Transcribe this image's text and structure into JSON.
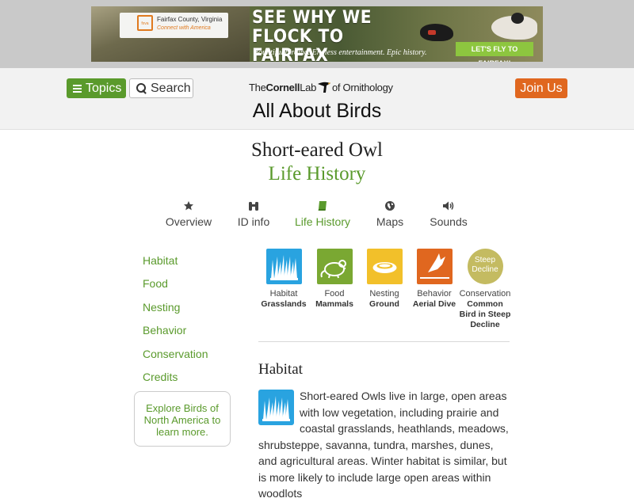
{
  "ad": {
    "county": "Fairfax County, Virginia",
    "connect": "Connect with America",
    "logo_mark": "fxva",
    "headline": "SEE WHY WE FLOCK TO FAIRFAX COUNTY.",
    "subline": "Bountiful birding. Endless entertainment. Epic history.",
    "cta": "LET'S FLY TO FAIRFAX!"
  },
  "header": {
    "topics": "Topics",
    "search": "Search",
    "logo_the": "The",
    "logo_cornell": "Cornell",
    "logo_lab": "Lab",
    "logo_of": "of Ornithology",
    "site_title": "All About Birds",
    "join": "Join Us"
  },
  "page": {
    "species": "Short-eared Owl",
    "section": "Life History"
  },
  "tabs": [
    {
      "label": "Overview",
      "icon": "star-icon"
    },
    {
      "label": "ID info",
      "icon": "binoculars-icon"
    },
    {
      "label": "Life History",
      "icon": "book-icon",
      "active": true
    },
    {
      "label": "Maps",
      "icon": "globe-icon"
    },
    {
      "label": "Sounds",
      "icon": "speaker-icon"
    }
  ],
  "sidebar": {
    "links": [
      "Habitat",
      "Food",
      "Nesting",
      "Behavior",
      "Conservation",
      "Credits"
    ],
    "explore": "Explore Birds of North America to learn more."
  },
  "attributes": [
    {
      "label": "Habitat",
      "value": "Grasslands",
      "icon": "grasslands-icon",
      "color": "#29a3e0"
    },
    {
      "label": "Food",
      "value": "Mammals",
      "icon": "mammal-icon",
      "color": "#7aa832"
    },
    {
      "label": "Nesting",
      "value": "Ground",
      "icon": "nest-icon",
      "color": "#f2c02a"
    },
    {
      "label": "Behavior",
      "value": "Aerial Dive",
      "icon": "diving-bird-icon",
      "color": "#e0671f"
    },
    {
      "label": "Conservation",
      "value": "Common Bird in Steep Decline",
      "badge": "Steep Decline",
      "color": "#c4bb61"
    }
  ],
  "habitat": {
    "heading": "Habitat",
    "text": "Short-eared Owls live in large, open areas with low vegetation, including prairie and coastal grasslands, heathlands, meadows, shrubsteppe, savanna, tundra, marshes, dunes, and agricultural areas. Winter habitat is similar, but is more likely to include large open areas within woodlots"
  },
  "colors": {
    "accent_green": "#5a9a2c",
    "join_orange": "#e0671f"
  }
}
